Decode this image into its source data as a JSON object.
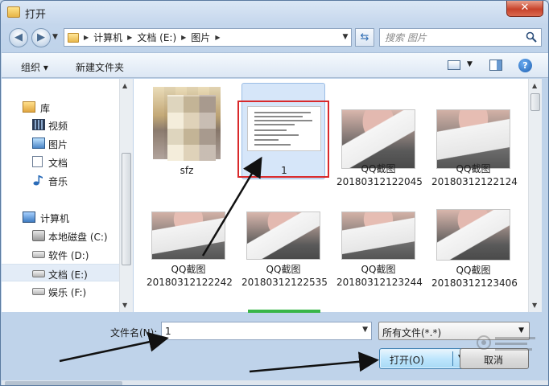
{
  "window": {
    "title": "打开",
    "close_label": "✕"
  },
  "address": {
    "breadcrumbs": [
      "计算机",
      "文档 (E:)",
      "图片"
    ],
    "search_placeholder": "搜索 图片"
  },
  "toolbar": {
    "organize_label": "组织 ▾",
    "new_folder_label": "新建文件夹",
    "help_label": "?"
  },
  "sidebar": {
    "library_label": "库",
    "items": [
      {
        "label": "视频",
        "icon": "video-icon"
      },
      {
        "label": "图片",
        "icon": "pictures-icon"
      },
      {
        "label": "文档",
        "icon": "documents-icon"
      },
      {
        "label": "音乐",
        "icon": "music-icon"
      }
    ],
    "computer_label": "计算机",
    "drives": [
      {
        "label": "本地磁盘 (C:)",
        "selected": false
      },
      {
        "label": "软件 (D:)",
        "selected": false
      },
      {
        "label": "文档 (E:)",
        "selected": true
      },
      {
        "label": "娱乐 (F:)",
        "selected": false
      }
    ]
  },
  "files": [
    {
      "name": "sfz",
      "type": "folder"
    },
    {
      "name": "1",
      "type": "document",
      "selected": true
    },
    {
      "name": "QQ截图\n20180312122045",
      "type": "image"
    },
    {
      "name": "QQ截图\n20180312122124",
      "type": "image"
    },
    {
      "name": "QQ截图\n20180312122242",
      "type": "image"
    },
    {
      "name": "QQ截图\n20180312122535",
      "type": "image"
    },
    {
      "name": "QQ截图\n20180312123244",
      "type": "image"
    },
    {
      "name": "QQ截图\n20180312123406",
      "type": "image"
    }
  ],
  "bottom": {
    "filename_label": "文件名(N):",
    "filename_value": "1",
    "filetype_value": "所有文件(*.*)",
    "open_label": "打开(O)",
    "cancel_label": "取消"
  },
  "colors": {
    "highlight": "#d9292b",
    "accent": "#2f6db3",
    "green_bar": "#38b548"
  }
}
